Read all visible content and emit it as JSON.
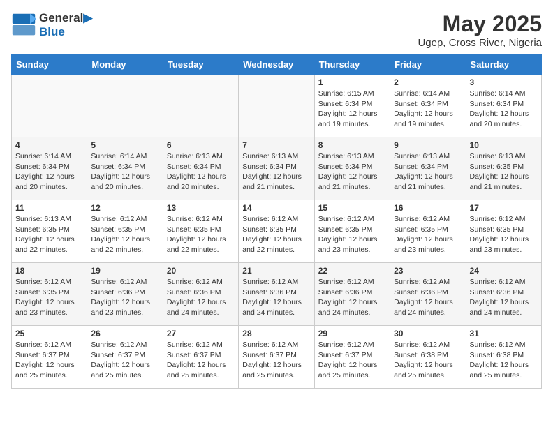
{
  "header": {
    "logo_line1": "General",
    "logo_line2": "Blue",
    "month": "May 2025",
    "location": "Ugep, Cross River, Nigeria"
  },
  "days_of_week": [
    "Sunday",
    "Monday",
    "Tuesday",
    "Wednesday",
    "Thursday",
    "Friday",
    "Saturday"
  ],
  "weeks": [
    [
      {
        "day": "",
        "info": ""
      },
      {
        "day": "",
        "info": ""
      },
      {
        "day": "",
        "info": ""
      },
      {
        "day": "",
        "info": ""
      },
      {
        "day": "1",
        "info": "Sunrise: 6:15 AM\nSunset: 6:34 PM\nDaylight: 12 hours and 19 minutes."
      },
      {
        "day": "2",
        "info": "Sunrise: 6:14 AM\nSunset: 6:34 PM\nDaylight: 12 hours and 19 minutes."
      },
      {
        "day": "3",
        "info": "Sunrise: 6:14 AM\nSunset: 6:34 PM\nDaylight: 12 hours and 20 minutes."
      }
    ],
    [
      {
        "day": "4",
        "info": "Sunrise: 6:14 AM\nSunset: 6:34 PM\nDaylight: 12 hours and 20 minutes."
      },
      {
        "day": "5",
        "info": "Sunrise: 6:14 AM\nSunset: 6:34 PM\nDaylight: 12 hours and 20 minutes."
      },
      {
        "day": "6",
        "info": "Sunrise: 6:13 AM\nSunset: 6:34 PM\nDaylight: 12 hours and 20 minutes."
      },
      {
        "day": "7",
        "info": "Sunrise: 6:13 AM\nSunset: 6:34 PM\nDaylight: 12 hours and 21 minutes."
      },
      {
        "day": "8",
        "info": "Sunrise: 6:13 AM\nSunset: 6:34 PM\nDaylight: 12 hours and 21 minutes."
      },
      {
        "day": "9",
        "info": "Sunrise: 6:13 AM\nSunset: 6:34 PM\nDaylight: 12 hours and 21 minutes."
      },
      {
        "day": "10",
        "info": "Sunrise: 6:13 AM\nSunset: 6:35 PM\nDaylight: 12 hours and 21 minutes."
      }
    ],
    [
      {
        "day": "11",
        "info": "Sunrise: 6:13 AM\nSunset: 6:35 PM\nDaylight: 12 hours and 22 minutes."
      },
      {
        "day": "12",
        "info": "Sunrise: 6:12 AM\nSunset: 6:35 PM\nDaylight: 12 hours and 22 minutes."
      },
      {
        "day": "13",
        "info": "Sunrise: 6:12 AM\nSunset: 6:35 PM\nDaylight: 12 hours and 22 minutes."
      },
      {
        "day": "14",
        "info": "Sunrise: 6:12 AM\nSunset: 6:35 PM\nDaylight: 12 hours and 22 minutes."
      },
      {
        "day": "15",
        "info": "Sunrise: 6:12 AM\nSunset: 6:35 PM\nDaylight: 12 hours and 23 minutes."
      },
      {
        "day": "16",
        "info": "Sunrise: 6:12 AM\nSunset: 6:35 PM\nDaylight: 12 hours and 23 minutes."
      },
      {
        "day": "17",
        "info": "Sunrise: 6:12 AM\nSunset: 6:35 PM\nDaylight: 12 hours and 23 minutes."
      }
    ],
    [
      {
        "day": "18",
        "info": "Sunrise: 6:12 AM\nSunset: 6:35 PM\nDaylight: 12 hours and 23 minutes."
      },
      {
        "day": "19",
        "info": "Sunrise: 6:12 AM\nSunset: 6:36 PM\nDaylight: 12 hours and 23 minutes."
      },
      {
        "day": "20",
        "info": "Sunrise: 6:12 AM\nSunset: 6:36 PM\nDaylight: 12 hours and 24 minutes."
      },
      {
        "day": "21",
        "info": "Sunrise: 6:12 AM\nSunset: 6:36 PM\nDaylight: 12 hours and 24 minutes."
      },
      {
        "day": "22",
        "info": "Sunrise: 6:12 AM\nSunset: 6:36 PM\nDaylight: 12 hours and 24 minutes."
      },
      {
        "day": "23",
        "info": "Sunrise: 6:12 AM\nSunset: 6:36 PM\nDaylight: 12 hours and 24 minutes."
      },
      {
        "day": "24",
        "info": "Sunrise: 6:12 AM\nSunset: 6:36 PM\nDaylight: 12 hours and 24 minutes."
      }
    ],
    [
      {
        "day": "25",
        "info": "Sunrise: 6:12 AM\nSunset: 6:37 PM\nDaylight: 12 hours and 25 minutes."
      },
      {
        "day": "26",
        "info": "Sunrise: 6:12 AM\nSunset: 6:37 PM\nDaylight: 12 hours and 25 minutes."
      },
      {
        "day": "27",
        "info": "Sunrise: 6:12 AM\nSunset: 6:37 PM\nDaylight: 12 hours and 25 minutes."
      },
      {
        "day": "28",
        "info": "Sunrise: 6:12 AM\nSunset: 6:37 PM\nDaylight: 12 hours and 25 minutes."
      },
      {
        "day": "29",
        "info": "Sunrise: 6:12 AM\nSunset: 6:37 PM\nDaylight: 12 hours and 25 minutes."
      },
      {
        "day": "30",
        "info": "Sunrise: 6:12 AM\nSunset: 6:38 PM\nDaylight: 12 hours and 25 minutes."
      },
      {
        "day": "31",
        "info": "Sunrise: 6:12 AM\nSunset: 6:38 PM\nDaylight: 12 hours and 25 minutes."
      }
    ]
  ]
}
